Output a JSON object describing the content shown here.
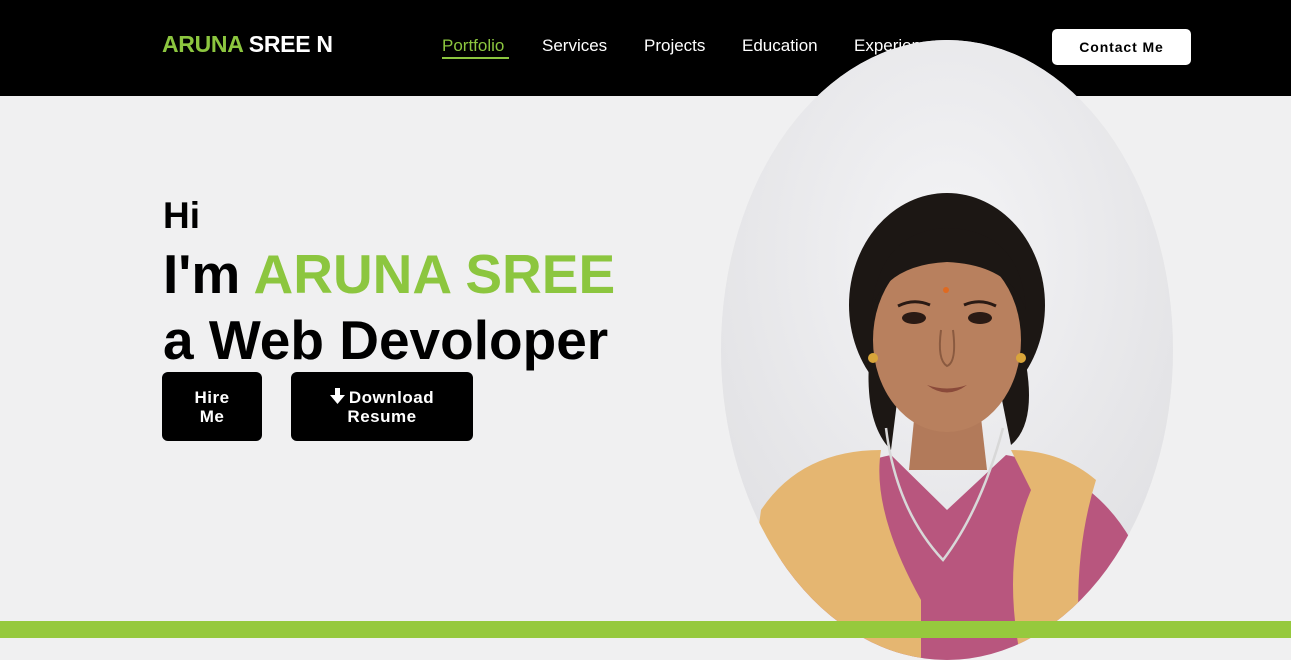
{
  "brand": {
    "first": "ARUNA",
    "last": "SREE N"
  },
  "nav": {
    "items": [
      {
        "label": "Portfolio",
        "active": true
      },
      {
        "label": "Services"
      },
      {
        "label": "Projects"
      },
      {
        "label": "Education"
      },
      {
        "label": "Experiences"
      }
    ],
    "contact_label": "Contact Me"
  },
  "hero": {
    "greeting": "Hi",
    "intro_prefix": "I'm",
    "name": "ARUNA SREE",
    "role": "a Web Devoloper",
    "hire_line1": "Hire",
    "hire_line2": "Me",
    "download_line1": "Download",
    "download_line2": "Resume"
  },
  "icons": {
    "download": "download-arrow-icon"
  },
  "colors": {
    "accent": "#8cc63f",
    "nav_bg": "#000000",
    "page_bg": "#f0f0f1",
    "footer_bar": "#96c93d"
  }
}
